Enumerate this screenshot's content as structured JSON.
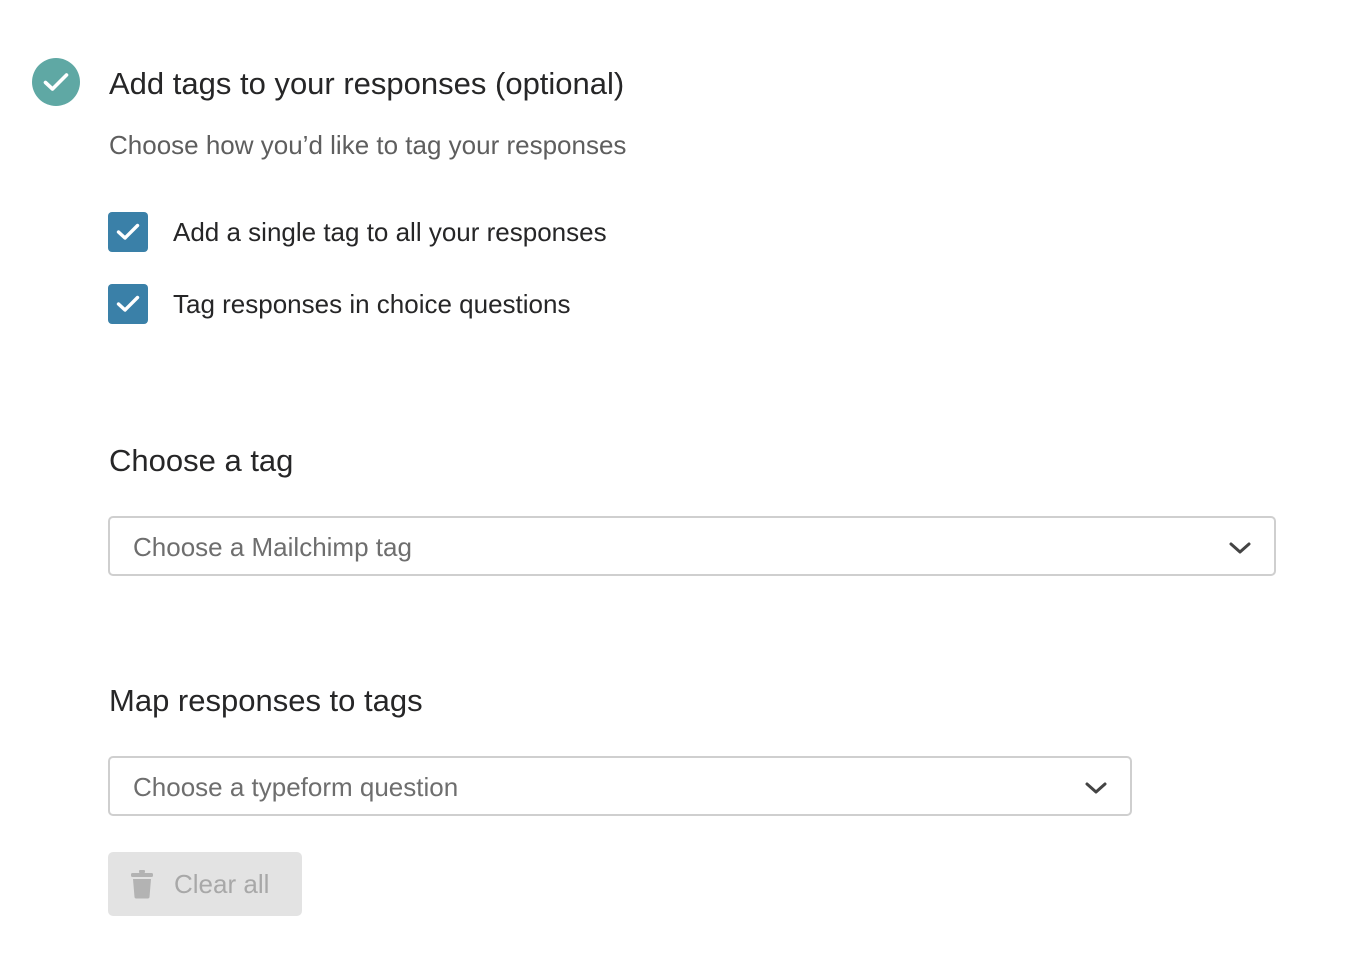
{
  "step": {
    "status_icon": "check-circle-icon",
    "title": "Add tags to your responses (optional)",
    "subtitle": "Choose how you’d like to tag your responses"
  },
  "options": [
    {
      "label": "Add a single tag to all your responses",
      "checked": true
    },
    {
      "label": "Tag responses in choice questions",
      "checked": true
    }
  ],
  "choose_tag": {
    "title": "Choose a tag",
    "select_placeholder": "Choose a Mailchimp tag"
  },
  "map_responses": {
    "title": "Map responses to tags",
    "select_placeholder": "Choose a typeform question",
    "clear_label": "Clear all"
  },
  "colors": {
    "step_icon": "#5fa8a4",
    "checkbox": "#3a80a8",
    "select_border": "#cfcfcf",
    "disabled_button": "#e3e3e3"
  }
}
